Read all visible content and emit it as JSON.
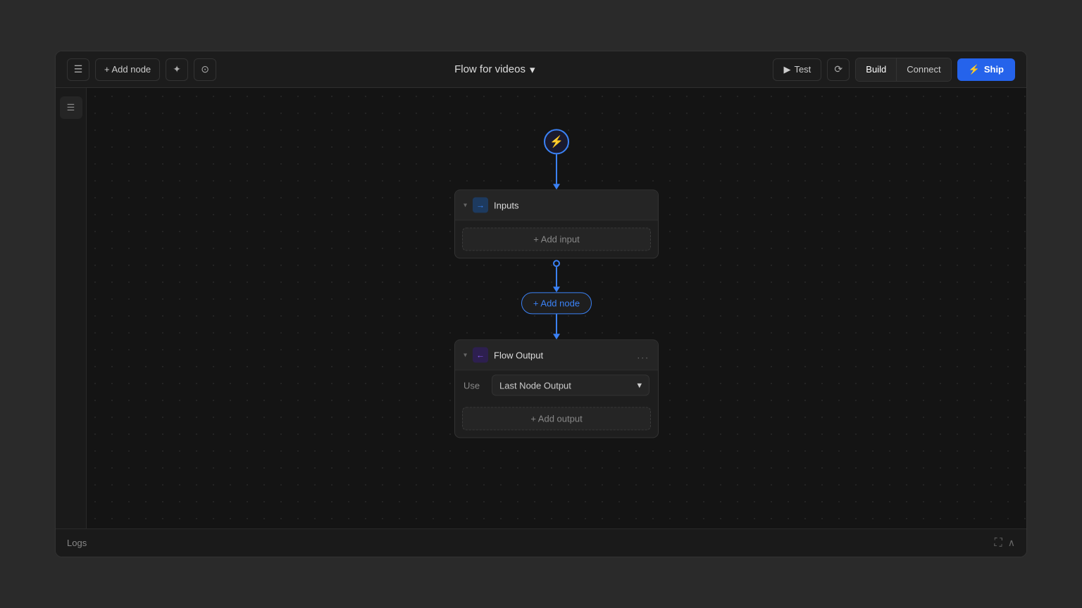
{
  "header": {
    "menu_icon": "☰",
    "add_node_label": "+ Add node",
    "wand_icon": "✦",
    "search_icon": "⊙",
    "flow_title": "Flow for videos",
    "chevron_icon": "▾",
    "test_label": "Test",
    "play_icon": "▶",
    "history_icon": "⟳",
    "build_label": "Build",
    "connect_label": "Connect",
    "ship_icon": "⚡",
    "ship_label": "Ship"
  },
  "sidebar": {
    "menu_icon": "☰"
  },
  "flow": {
    "trigger_icon": "⚡",
    "inputs_node": {
      "collapse_icon": "▾",
      "icon": "→",
      "title": "Inputs",
      "add_input_label": "+ Add input"
    },
    "add_node": {
      "label": "+ Add node"
    },
    "output_node": {
      "collapse_icon": "▾",
      "icon": "←",
      "title": "Flow Output",
      "more_icon": "...",
      "use_label": "Use",
      "select_value": "Last Node Output",
      "select_chevron": "▾",
      "add_output_label": "+ Add output"
    }
  },
  "logs": {
    "label": "Logs",
    "expand_icon": "⛶",
    "chevron_icon": "∧"
  }
}
